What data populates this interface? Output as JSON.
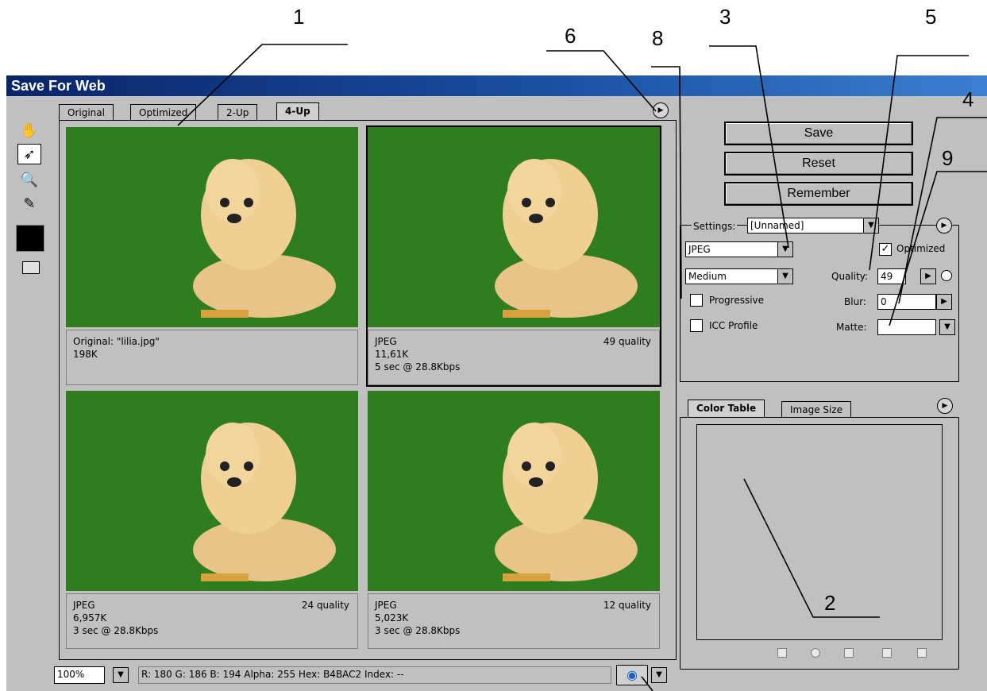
{
  "callouts": [
    "1",
    "2",
    "3",
    "4",
    "5",
    "6",
    "8",
    "9"
  ],
  "window": {
    "title": "Save For Web"
  },
  "tabs": [
    "Original",
    "Optimized",
    "2-Up",
    "4-Up"
  ],
  "active_tab": "4-Up",
  "panes": [
    {
      "line1": "Original: \"lilia.jpg\"",
      "line2": "198K",
      "line3": "",
      "right": ""
    },
    {
      "line1": "JPEG",
      "line2": "11,61K",
      "line3": "5 sec @ 28.8Kbps",
      "right": "49 quality"
    },
    {
      "line1": "JPEG",
      "line2": "6,957K",
      "line3": "3 sec @ 28.8Kbps",
      "right": "24 quality"
    },
    {
      "line1": "JPEG",
      "line2": "5,023K",
      "line3": "3 sec @ 28.8Kbps",
      "right": "12 quality"
    }
  ],
  "buttons": {
    "save": "Save",
    "reset": "Reset",
    "remember": "Remember"
  },
  "settings": {
    "label": "Settings:",
    "preset": "[Unnamed]",
    "format": "JPEG",
    "quality_preset": "Medium",
    "optimized_label": "Optimized",
    "optimized_checked": true,
    "quality_label": "Quality:",
    "quality_value": "49",
    "blur_label": "Blur:",
    "blur_value": "0",
    "matte_label": "Matte:",
    "progressive_label": "Progressive",
    "icc_label": "ICC Profile"
  },
  "panel_tabs": [
    "Color Table",
    "Image Size"
  ],
  "status": {
    "zoom": "100%",
    "readout": "R: 180   G: 186   B: 194   Alpha: 255   Hex:  B4BAC2   Index:     --"
  },
  "colors": {
    "title_start": "#0a246a",
    "title_end": "#3b7fd0",
    "chrome": "#c0c0c0",
    "grass": "#2f7d1e"
  },
  "icons": [
    "hand-icon",
    "slice-select-icon",
    "zoom-icon",
    "eyedropper-icon",
    "swatch-icon",
    "toggle-slices-icon",
    "browser-preview-icon",
    "menu-arrow-icon"
  ]
}
